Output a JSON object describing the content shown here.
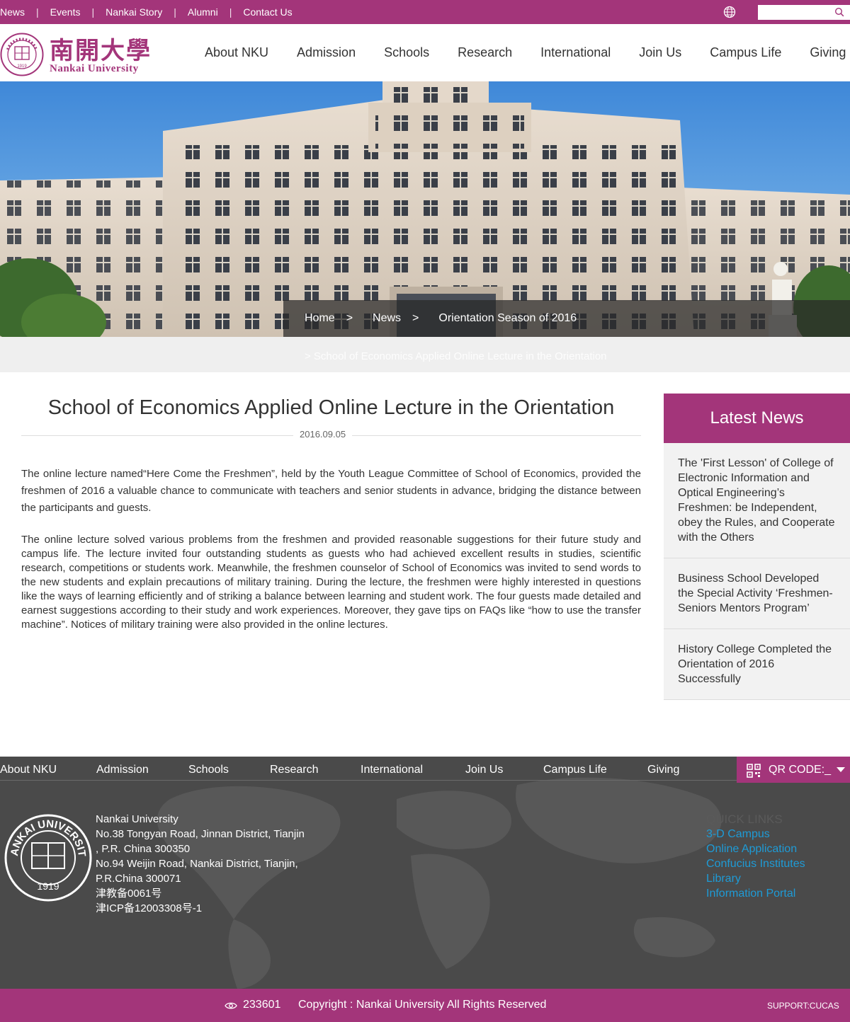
{
  "topbar": {
    "links": [
      "News",
      "Events",
      "Nankai Story",
      "Alumni",
      "Contact Us"
    ],
    "search_placeholder": ""
  },
  "header": {
    "logo_cn": "南開大學",
    "logo_en": "Nankai University",
    "seal_year": "1919",
    "nav": [
      "About NKU",
      "Admission",
      "Schools",
      "Research",
      "International",
      "Join Us",
      "Campus Life",
      "Giving"
    ]
  },
  "breadcrumb": {
    "home": "Home",
    "news": "News",
    "section": "Orientation Season of 2016",
    "sep": ">",
    "ghost": ">   School of Economics Applied Online Lecture in the Orientation"
  },
  "article": {
    "title": "School of Economics Applied Online Lecture in the Orientation",
    "date": "2016.09.05",
    "paragraphs": [
      "The online lecture named“Here Come the Freshmen”, held by the Youth League Committee of School of Economics, provided the freshmen of 2016 a valuable chance to communicate with teachers and senior students in advance, bridging the distance between the participants and guests.",
      "The online lecture solved various problems from the freshmen and provided reasonable suggestions for their future study and campus life. The lecture invited four outstanding students as guests who had achieved excellent results in studies, scientific research, competitions or students work. Meanwhile, the freshmen counselor of School of Economics was invited to send words to the new students and explain precautions of military training. During the lecture, the freshmen were highly interested in questions like the ways of learning efficiently and of striking a balance between learning and student work. The four guests made detailed and earnest suggestions according to their study and work experiences. Moreover, they gave tips on FAQs like “how to use the transfer machine”. Notices of military training were also provided in the online lectures."
    ]
  },
  "sidebar": {
    "heading": "Latest News",
    "items": [
      "The 'First Lesson' of College of Electronic Information and Optical Engineering’s Freshmen: be Independent, obey the Rules, and Cooperate with the Others",
      "Business School Developed the Special Activity ‘Freshmen-Seniors Mentors Program’",
      "History College Completed the Orientation of 2016 Successfully"
    ]
  },
  "footer": {
    "nav": [
      "About NKU",
      "Admission",
      "Schools",
      "Research",
      "International",
      "Join Us",
      "Campus Life",
      "Giving"
    ],
    "qr_label": "QR CODE:_",
    "address_lines": [
      "Nankai University",
      "No.38 Tongyan Road, Jinnan District, Tianjin",
      ", P.R. China 300350",
      "No.94 Weijin Road,  Nankai District, Tianjin,",
      "P.R.China  300071",
      "津教备0061号",
      "津ICP备12003308号-1"
    ],
    "seal_text": "NANKAI UNIVERSITY",
    "seal_year": "1919",
    "quick_links_heading": "QUICK LINKS",
    "quick_links": [
      "3-D Campus",
      "Online Application",
      "Confucius Institutes",
      "Library",
      "Information Portal"
    ]
  },
  "bottombar": {
    "visits": "233601",
    "copyright": "Copyright : Nankai University All Rights Reserved",
    "support": "SUPPORT:CUCAS"
  },
  "colors": {
    "brand": "#a3357a",
    "footer_bg": "#4a4a4a",
    "link_blue": "#1e9bd6"
  }
}
